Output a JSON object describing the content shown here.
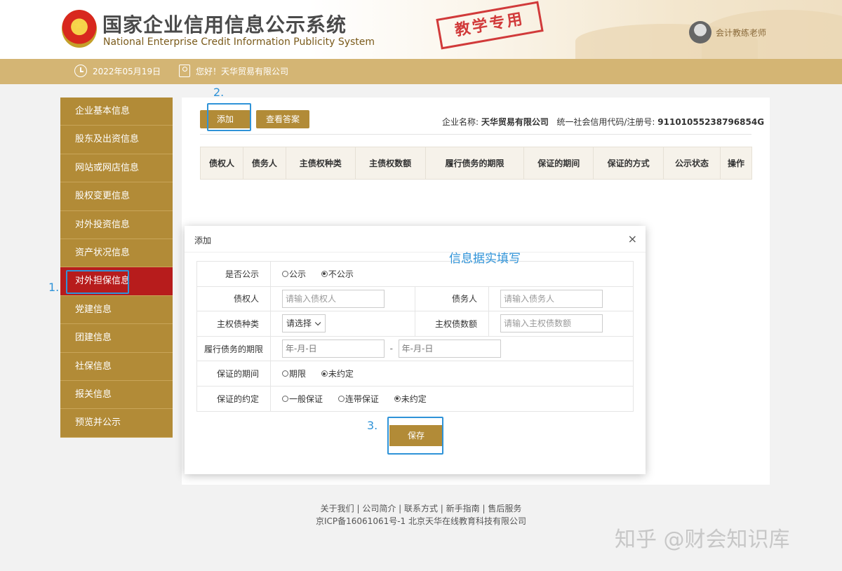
{
  "header": {
    "title_cn": "国家企业信用信息公示系统",
    "title_en": "National Enterprise Credit Information Publicity System",
    "stamp": "教学专用",
    "user_name": "会计教练老师"
  },
  "infobar": {
    "date": "2022年05月19日",
    "greeting": "您好！天华贸易有限公司"
  },
  "sidebar": {
    "items": [
      {
        "label": "企业基本信息"
      },
      {
        "label": "股东及出资信息"
      },
      {
        "label": "网站或网店信息"
      },
      {
        "label": "股权变更信息"
      },
      {
        "label": "对外投资信息"
      },
      {
        "label": "资产状况信息"
      },
      {
        "label": "对外担保信息"
      },
      {
        "label": "党建信息"
      },
      {
        "label": "团建信息"
      },
      {
        "label": "社保信息"
      },
      {
        "label": "报关信息"
      },
      {
        "label": "预览并公示"
      }
    ],
    "active_index": 6
  },
  "toolbar": {
    "add_label": "添加",
    "answer_label": "查看答案"
  },
  "company": {
    "name_label": "企业名称:",
    "name": "天华贸易有限公司",
    "code_label": "统一社会信用代码/注册号:",
    "code": "91101055238796854G"
  },
  "table": {
    "columns": [
      "债权人",
      "债务人",
      "主债权种类",
      "主债权数额",
      "履行债务的期限",
      "保证的期间",
      "保证的方式",
      "公示状态",
      "操作"
    ]
  },
  "annotations": {
    "step1": "1.",
    "step2": "2.",
    "step3": "3.",
    "note": "信息据实填写"
  },
  "modal": {
    "title": "添加",
    "close": "×",
    "publicize": {
      "label": "是否公示",
      "options": [
        "公示",
        "不公示"
      ],
      "selected": "不公示"
    },
    "creditor": {
      "label": "债权人",
      "placeholder": "请输入债权人"
    },
    "debtor": {
      "label": "债务人",
      "placeholder": "请输入债务人"
    },
    "claim_type": {
      "label": "主权债种类",
      "value": "请选择"
    },
    "claim_amount": {
      "label": "主权债数额",
      "placeholder": "请输入主权债数额"
    },
    "term": {
      "label": "履行债务的期限",
      "start_placeholder": "年-月-日",
      "separator": "-",
      "end_placeholder": "年-月-日"
    },
    "period": {
      "label": "保证的期间",
      "options": [
        "期限",
        "未约定"
      ],
      "selected": "未约定"
    },
    "method": {
      "label": "保证的约定",
      "options": [
        "一般保证",
        "连带保证",
        "未约定"
      ],
      "selected": "未约定"
    },
    "save_label": "保存"
  },
  "footer": {
    "links": "关于我们 | 公司简介 | 联系方式 | 新手指南 | 售后服务",
    "icp": "京ICP备16061061号-1 北京天华在线教育科技有限公司"
  },
  "watermark": "知乎 @财会知识库",
  "colors": {
    "gold": "#b28b37",
    "bar": "#d4b574",
    "active": "#b71c1c",
    "annotation": "#2f93d8"
  }
}
